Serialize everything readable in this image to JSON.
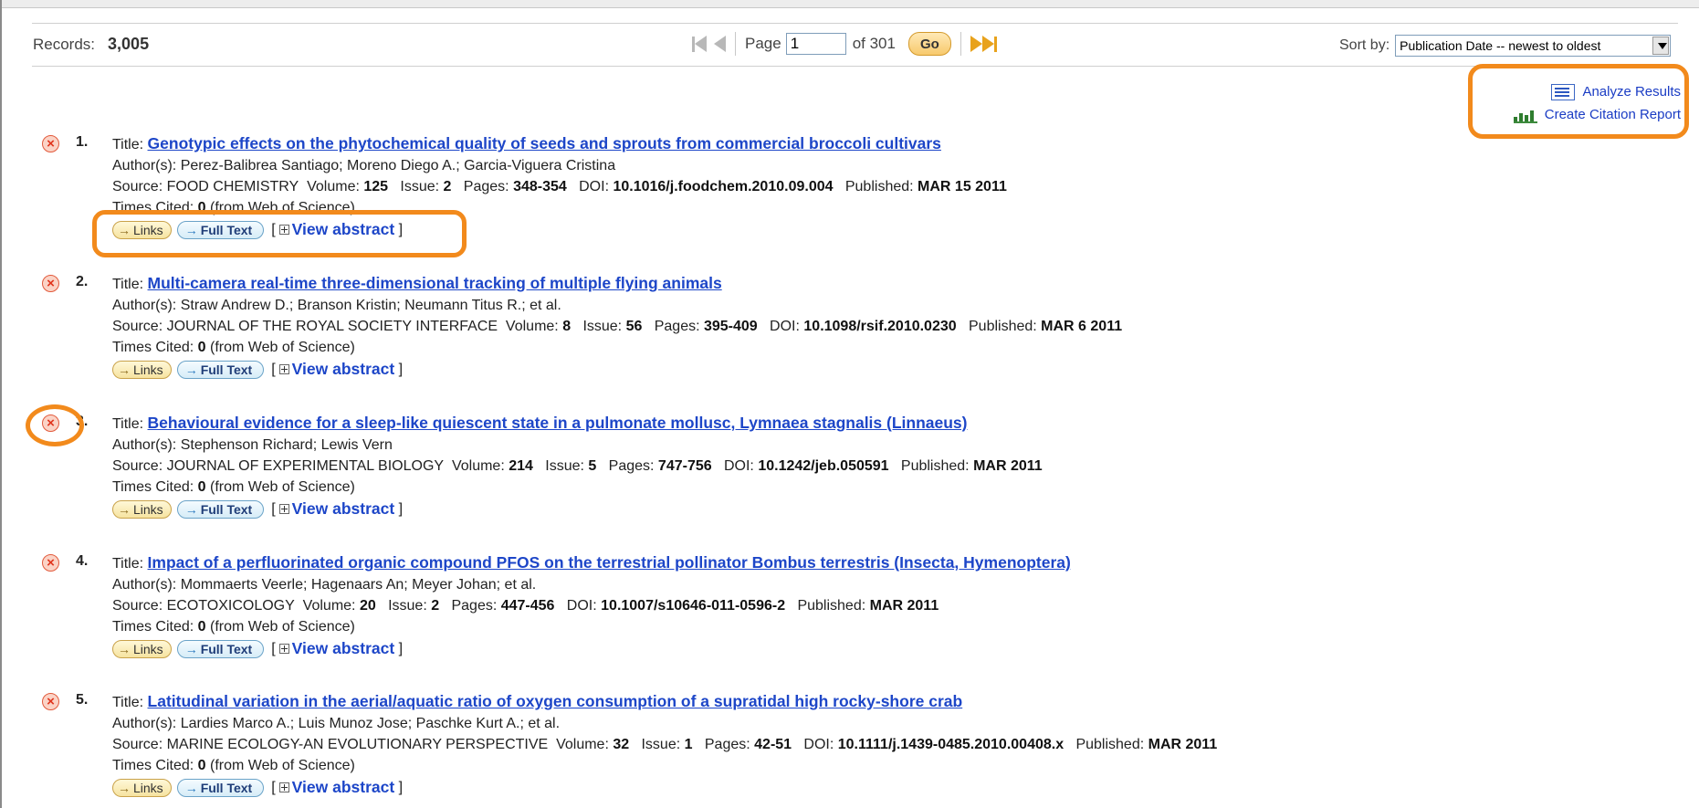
{
  "toolbar": {
    "records_label": "Records:",
    "records_count": "3,005",
    "page_label": "Page",
    "page_value": "1",
    "of_label": "of 301",
    "go_label": "Go",
    "sort_label": "Sort by:",
    "sort_value": "Publication Date -- newest to oldest"
  },
  "tools": {
    "analyze": "Analyze Results",
    "citation": "Create Citation Report"
  },
  "labels": {
    "title": "Title:",
    "authors": "Author(s):",
    "source": "Source:",
    "volume": "Volume:",
    "issue": "Issue:",
    "pages": "Pages:",
    "doi": "DOI:",
    "published": "Published:",
    "times_cited": "Times Cited:",
    "from_wos": "(from Web of Science)",
    "links": "Links",
    "full_text": "Full Text",
    "bracket_open": "[",
    "bracket_close": "]",
    "view_abstract": "View abstract"
  },
  "records": [
    {
      "num": "1.",
      "title": "Genotypic effects on the phytochemical quality of seeds and sprouts from commercial broccoli cultivars",
      "authors": "Perez-Balibrea Santiago; Moreno Diego A.; Garcia-Viguera Cristina",
      "source": "FOOD CHEMISTRY",
      "volume": "125",
      "issue": "2",
      "pages": "348-354",
      "doi": "10.1016/j.foodchem.2010.09.004",
      "published": "MAR 15 2011",
      "times_cited": "0"
    },
    {
      "num": "2.",
      "title": "Multi-camera real-time three-dimensional tracking of multiple flying animals",
      "authors": "Straw Andrew D.; Branson Kristin; Neumann Titus R.; et al.",
      "source": "JOURNAL OF THE ROYAL SOCIETY INTERFACE",
      "volume": "8",
      "issue": "56",
      "pages": "395-409",
      "doi": "10.1098/rsif.2010.0230",
      "published": "MAR 6 2011",
      "times_cited": "0"
    },
    {
      "num": "3.",
      "title": "Behavioural evidence for a sleep-like quiescent state in a pulmonate mollusc, Lymnaea stagnalis (Linnaeus)",
      "authors": "Stephenson Richard; Lewis Vern",
      "source": "JOURNAL OF EXPERIMENTAL BIOLOGY",
      "volume": "214",
      "issue": "5",
      "pages": "747-756",
      "doi": "10.1242/jeb.050591",
      "published": "MAR 2011",
      "times_cited": "0"
    },
    {
      "num": "4.",
      "title": "Impact of a perfluorinated organic compound PFOS on the terrestrial pollinator Bombus terrestris (Insecta, Hymenoptera)",
      "authors": "Mommaerts Veerle; Hagenaars An; Meyer Johan; et al.",
      "source": "ECOTOXICOLOGY",
      "volume": "20",
      "issue": "2",
      "pages": "447-456",
      "doi": "10.1007/s10646-011-0596-2",
      "published": "MAR 2011",
      "times_cited": "0"
    },
    {
      "num": "5.",
      "title": "Latitudinal variation in the aerial/aquatic ratio of oxygen consumption of a supratidal high rocky-shore crab",
      "authors": "Lardies Marco A.; Luis Munoz Jose; Paschke Kurt A.; et al.",
      "source": "MARINE ECOLOGY-AN EVOLUTIONARY PERSPECTIVE",
      "volume": "32",
      "issue": "1",
      "pages": "42-51",
      "doi": "10.1111/j.1439-0485.2010.00408.x",
      "published": "MAR 2011",
      "times_cited": "0"
    }
  ]
}
